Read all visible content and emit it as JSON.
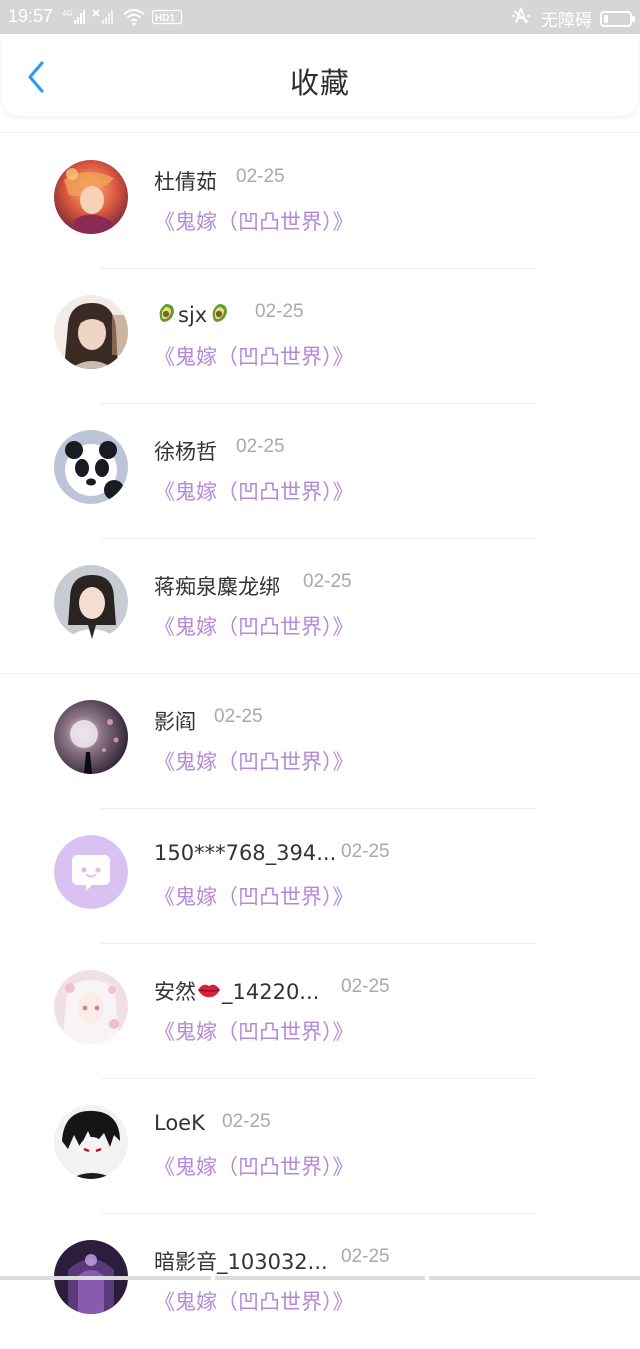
{
  "status_bar": {
    "time": "19:57",
    "network": "4G",
    "hd": "HD1",
    "accessibility": "无障碍"
  },
  "header": {
    "title": "收藏",
    "back_icon": "chevron-left-icon",
    "accent_color": "#2b9ef2"
  },
  "items": [
    {
      "name": "杜倩茹",
      "date": "02-25",
      "title": "《鬼嫁（凹凸世界）》"
    },
    {
      "name": "sjx",
      "prefix_icon": "avocado-icon",
      "suffix_icon": "avocado-icon",
      "date": "02-25",
      "title": "《鬼嫁（凹凸世界）》"
    },
    {
      "name": "徐杨哲",
      "date": "02-25",
      "title": "《鬼嫁（凹凸世界）》"
    },
    {
      "name": "蒋痴泉麋龙绑",
      "date": "02-25",
      "title": "《鬼嫁（凹凸世界）》"
    },
    {
      "name": "影阎",
      "date": "02-25",
      "title": "《鬼嫁（凹凸世界）》"
    },
    {
      "name": "150***768_394...",
      "date": "02-25",
      "title": "《鬼嫁（凹凸世界）》"
    },
    {
      "name_before": "安然",
      "inline_icon": "lips-icon",
      "name_after": "_14220...",
      "date": "02-25",
      "title": "《鬼嫁（凹凸世界）》"
    },
    {
      "name": "LoeK",
      "date": "02-25",
      "title": "《鬼嫁（凹凸世界）》"
    },
    {
      "name": "暗影音_103032...",
      "date": "02-25",
      "title": "《鬼嫁（凹凸世界）》"
    }
  ],
  "colors": {
    "title_purple": "#b48ad8",
    "date_gray": "#a9a9a9",
    "name_dark": "#333333",
    "default_avatar": "#d9c1f2"
  }
}
